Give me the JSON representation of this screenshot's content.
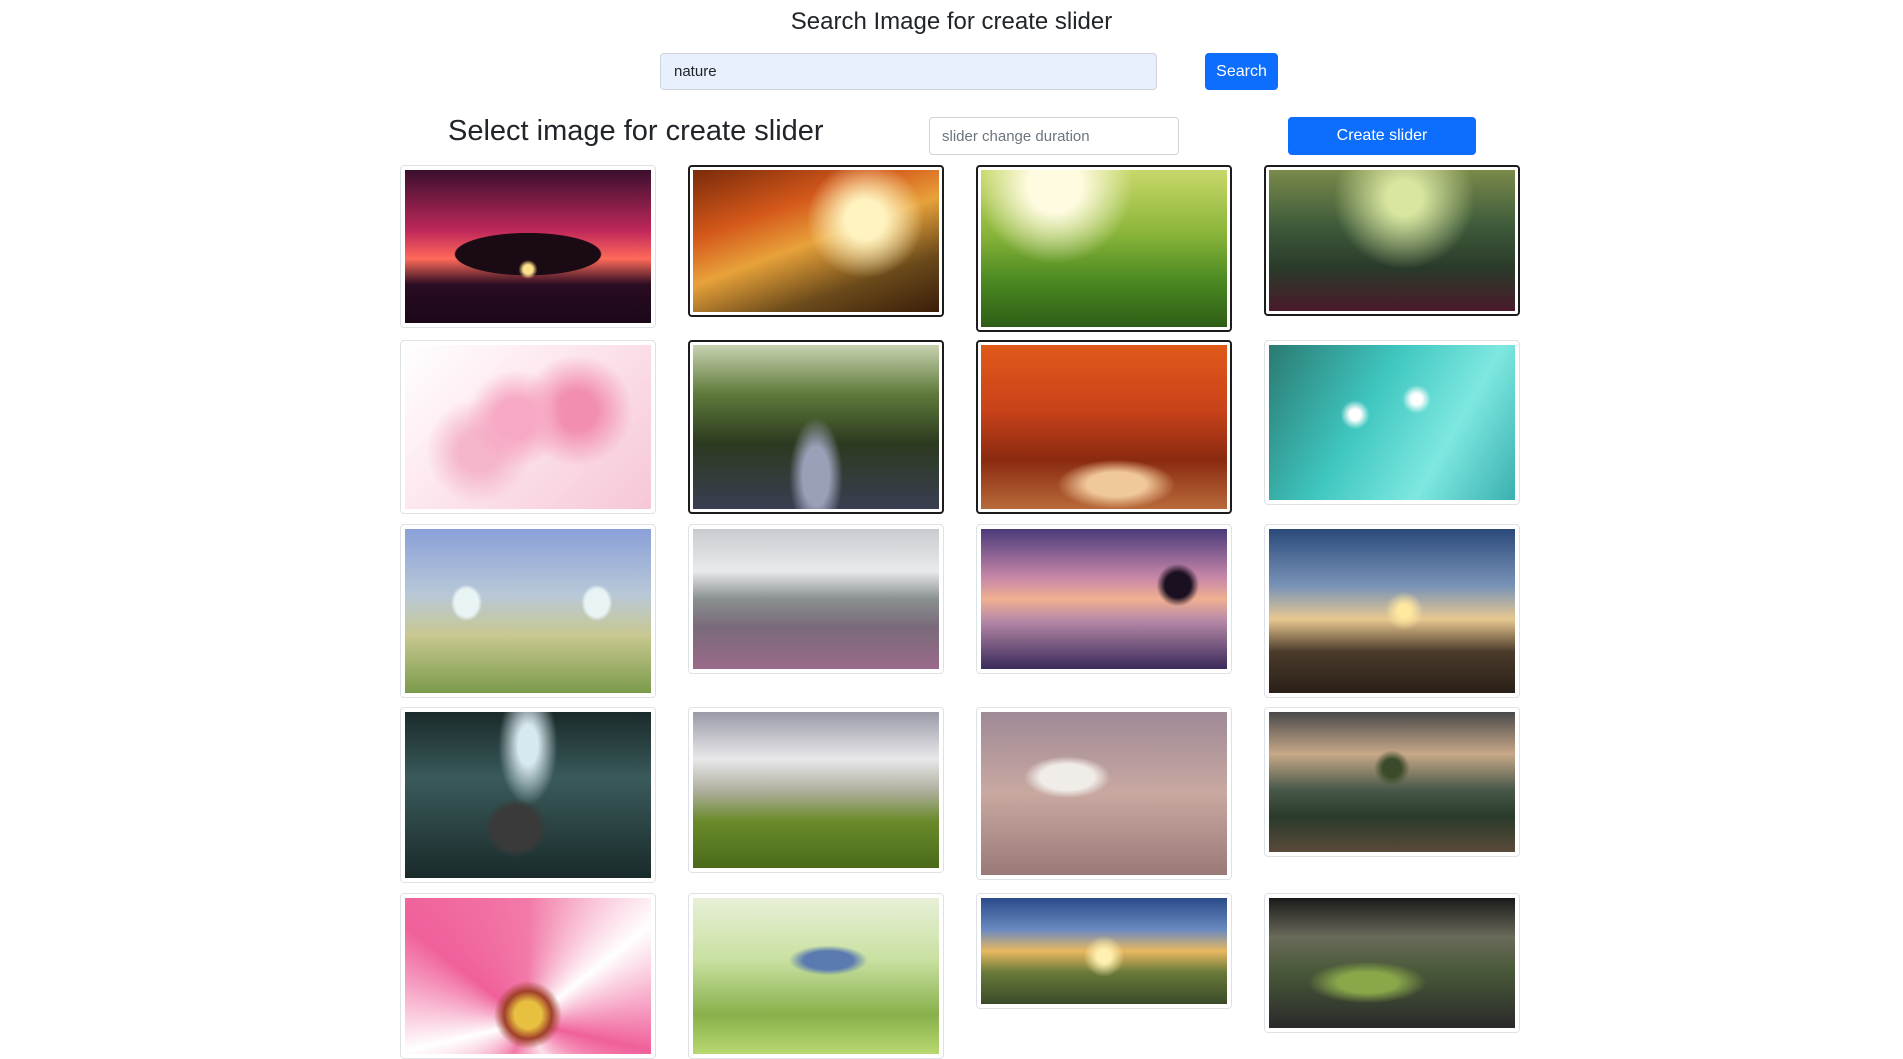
{
  "search": {
    "title": "Search Image for create slider",
    "value": "nature",
    "button_label": "Search"
  },
  "slider": {
    "title": "Select image for create slider",
    "duration_placeholder": "slider change duration",
    "create_label": "Create slider"
  },
  "images": [
    {
      "subject": "tree-sunset",
      "selected": false
    },
    {
      "subject": "autumn-forest-path",
      "selected": true
    },
    {
      "subject": "green-meadow-flowers",
      "selected": true
    },
    {
      "subject": "misty-forest",
      "selected": true
    },
    {
      "subject": "pink-cherry-blossom",
      "selected": false
    },
    {
      "subject": "forest-road-sunrays",
      "selected": true
    },
    {
      "subject": "red-autumn-park",
      "selected": true
    },
    {
      "subject": "dandelion-dew",
      "selected": false
    },
    {
      "subject": "butterflies-meadow",
      "selected": false
    },
    {
      "subject": "mountain-stone-path",
      "selected": false
    },
    {
      "subject": "lake-tree-dusk",
      "selected": false
    },
    {
      "subject": "mountain-sunset-clouds",
      "selected": false
    },
    {
      "subject": "elephant-forest-light",
      "selected": false
    },
    {
      "subject": "railway-field-clouds",
      "selected": false
    },
    {
      "subject": "bird-flying-branch",
      "selected": false
    },
    {
      "subject": "lake-island-trees",
      "selected": false
    },
    {
      "subject": "pink-daisy",
      "selected": false
    },
    {
      "subject": "bird-blossom-branch",
      "selected": false
    },
    {
      "subject": "sunrise-valley",
      "selected": false
    },
    {
      "subject": "dark-green-hills",
      "selected": false
    }
  ]
}
